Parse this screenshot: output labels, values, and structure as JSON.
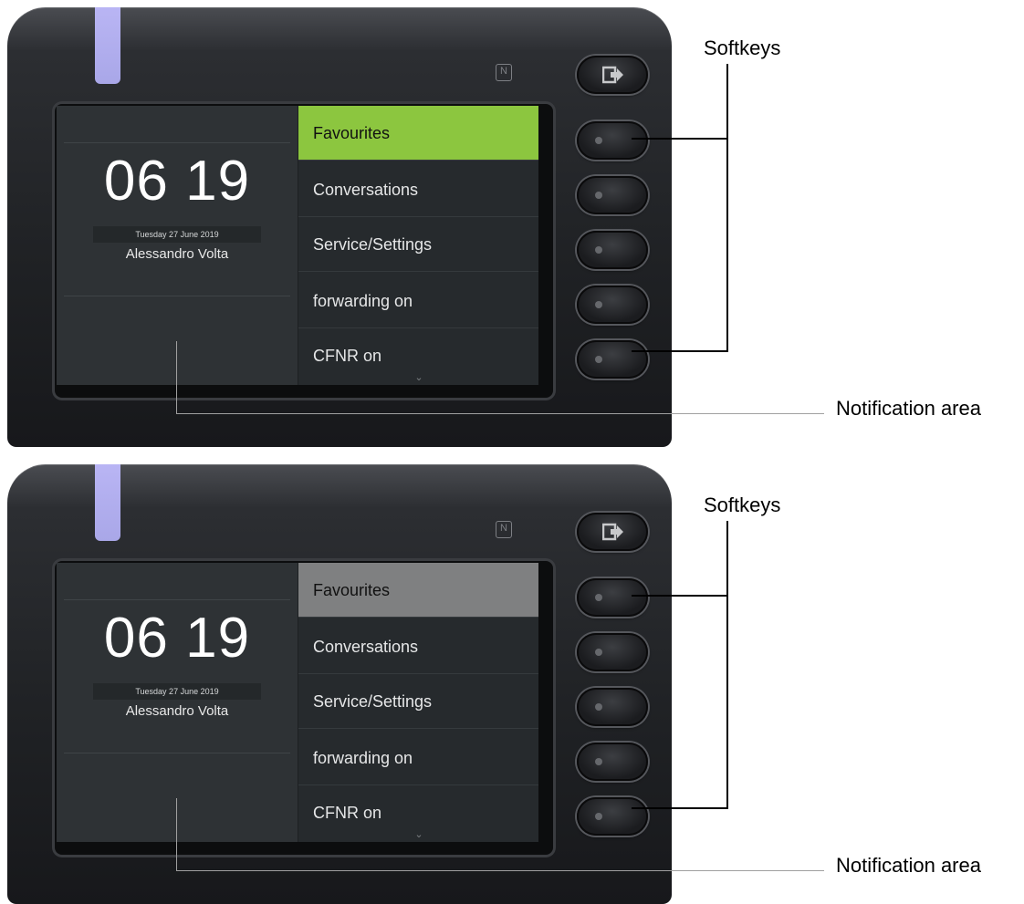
{
  "labels": {
    "softkeys": "Softkeys",
    "notification_area": "Notification area"
  },
  "panels": [
    {
      "time": "06 19",
      "date": "Tuesday 27 June 2019",
      "user": "Alessandro Volta",
      "selected_index": 0,
      "selected_color": "#8cc63f",
      "menu": [
        "Favourites",
        "Conversations",
        "Service/Settings",
        "forwarding on",
        "CFNR on"
      ]
    },
    {
      "time": "06 19",
      "date": "Tuesday 27 June 2019",
      "user": "Alessandro Volta",
      "selected_index": 0,
      "selected_color": "#7f8081",
      "menu": [
        "Favourites",
        "Conversations",
        "Service/Settings",
        "forwarding on",
        "CFNR on"
      ]
    }
  ],
  "icons": {
    "logout": "logout-icon",
    "nfc": "nfc-icon",
    "more": "chevron-down-icon"
  }
}
